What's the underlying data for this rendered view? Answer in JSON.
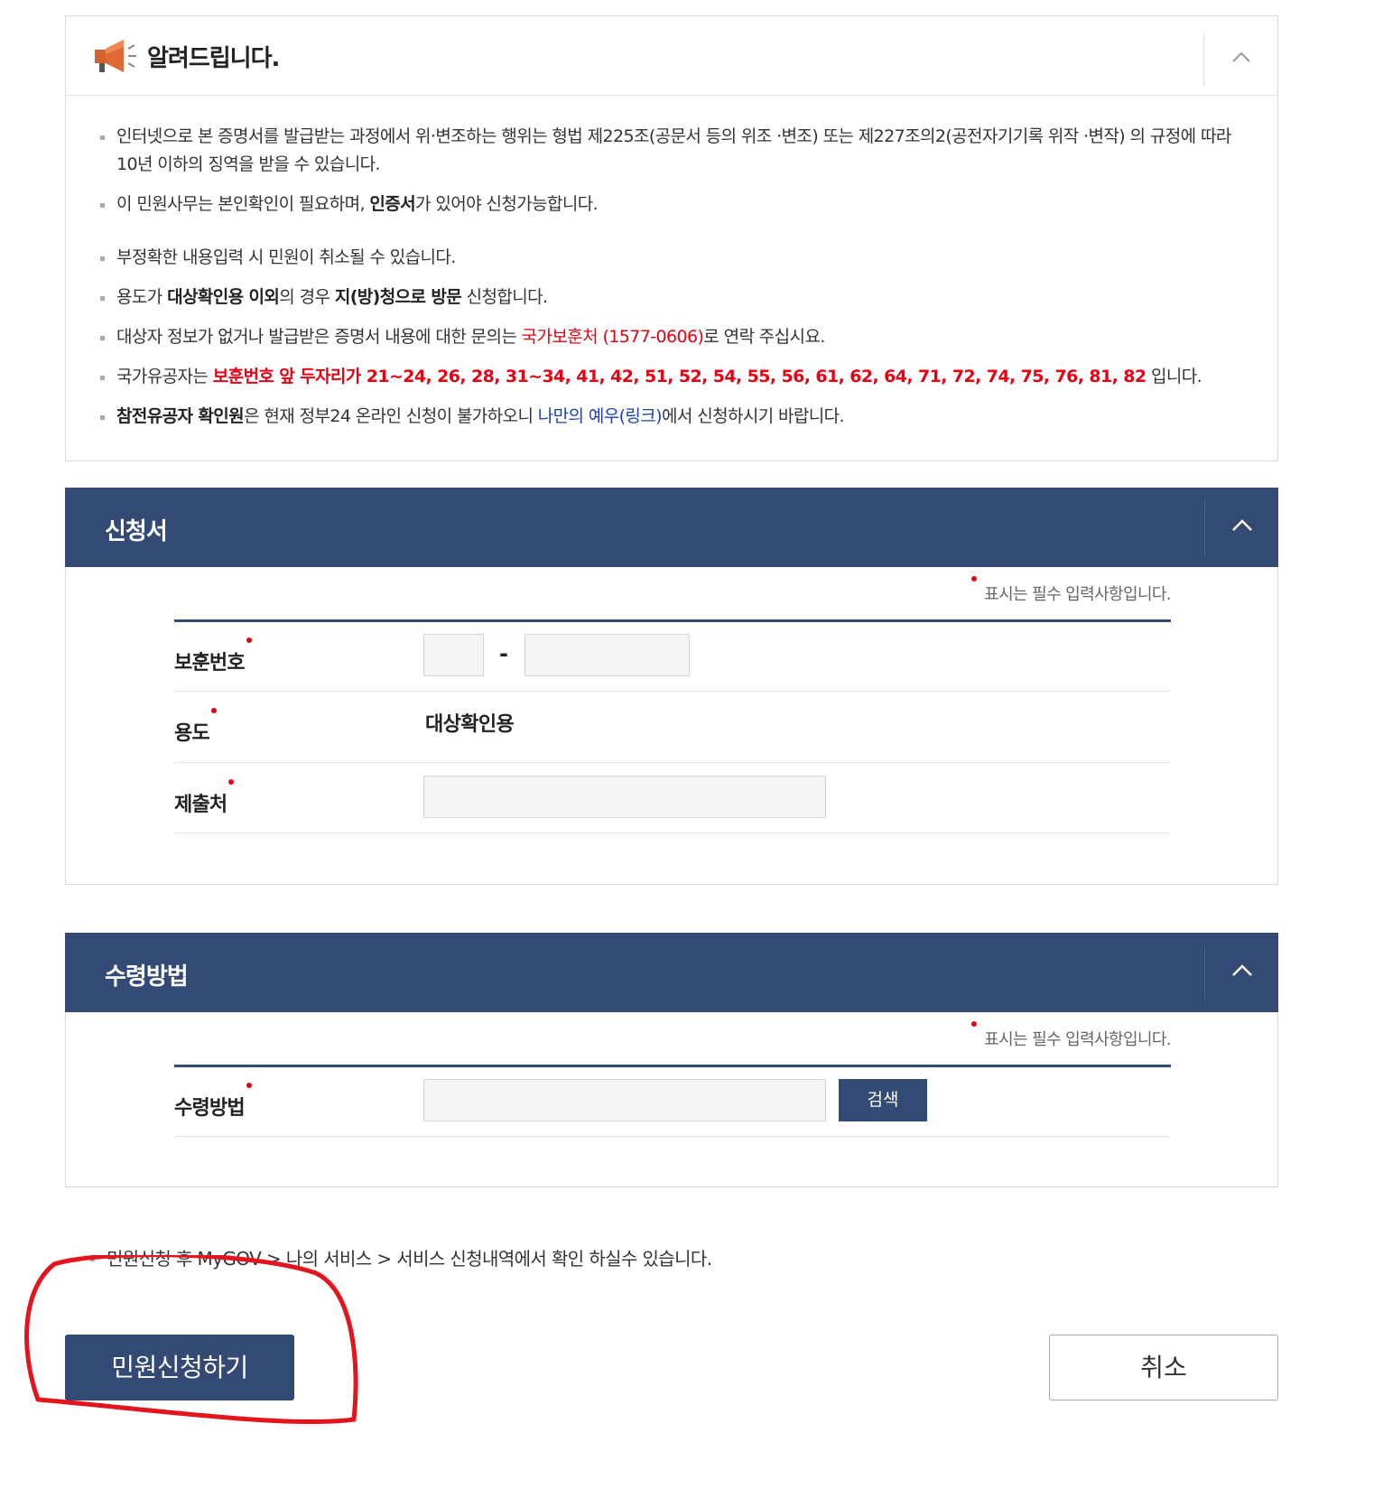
{
  "notice": {
    "title": "알려드립니다.",
    "items": [
      {
        "segments": [
          {
            "t": "인터넷으로 본 증명서를 발급받는 과정에서 위·변조하는 행위는 형법 제225조(공문서 등의 위조 ·변조) 또는 제227조의2(공전자기기록 위작 ·변작) 의 규정에 따라 10년 이하의 징역을 받을 수 있습니다.",
            "s": ""
          }
        ]
      },
      {
        "segments": [
          {
            "t": "이 민원사무는 본인확인이 필요하며, ",
            "s": ""
          },
          {
            "t": "인증서",
            "s": "b"
          },
          {
            "t": "가 있어야 신청가능합니다.",
            "s": ""
          }
        ]
      },
      {
        "segments": [
          {
            "t": "부정확한 내용입력 시 민원이 취소될 수 있습니다.",
            "s": ""
          }
        ]
      },
      {
        "segments": [
          {
            "t": "용도가 ",
            "s": ""
          },
          {
            "t": "대상확인용 이외",
            "s": "b"
          },
          {
            "t": "의 경우 ",
            "s": ""
          },
          {
            "t": "지(방)청으로 방문",
            "s": "b"
          },
          {
            "t": " 신청합니다.",
            "s": ""
          }
        ]
      },
      {
        "segments": [
          {
            "t": "대상자 정보가 없거나 발급받은 증명서 내용에 대한 문의는 ",
            "s": ""
          },
          {
            "t": "국가보훈처 (1577-0606)",
            "s": "red"
          },
          {
            "t": "로 연락 주십시요.",
            "s": ""
          }
        ]
      },
      {
        "segments": [
          {
            "t": "국가유공자는 ",
            "s": ""
          },
          {
            "t": "보훈번호 앞 두자리가 21~24, 26, 28, 31~34, 41, 42, 51, 52, 54, 55, 56, 61, 62, 64, 71, 72, 74, 75, 76, 81, 82",
            "s": "redb"
          },
          {
            "t": " 입니다.",
            "s": ""
          }
        ]
      },
      {
        "segments": [
          {
            "t": "참전유공자 확인원",
            "s": "b"
          },
          {
            "t": "은 현재 정부24 온라인 신청이 불가하오니 ",
            "s": ""
          },
          {
            "t": "나만의 예우(링크)",
            "s": "blue"
          },
          {
            "t": "에서 신청하시기 바랍니다.",
            "s": ""
          }
        ]
      }
    ]
  },
  "application": {
    "title": "신청서",
    "required_note": "표시는 필수 입력사항입니다.",
    "fields": {
      "bohun_label": "보훈번호",
      "bohun_sep": "-",
      "purpose_label": "용도",
      "purpose_value": "대상확인용",
      "submit_to_label": "제출처"
    }
  },
  "receipt": {
    "title": "수령방법",
    "required_note": "표시는 필수 입력사항입니다.",
    "method_label": "수령방법",
    "search_label": "검색"
  },
  "bottom_note": "민원신청 후 MyGOV > 나의 서비스 > 서비스 신청내역에서 확인 하실수 있습니다.",
  "buttons": {
    "apply": "민원신청하기",
    "cancel": "취소"
  },
  "colors": {
    "header_bg": "#334a75",
    "accent_red": "#e60012",
    "link_blue": "#1a3fb8",
    "annotation_red": "#e3141c"
  }
}
